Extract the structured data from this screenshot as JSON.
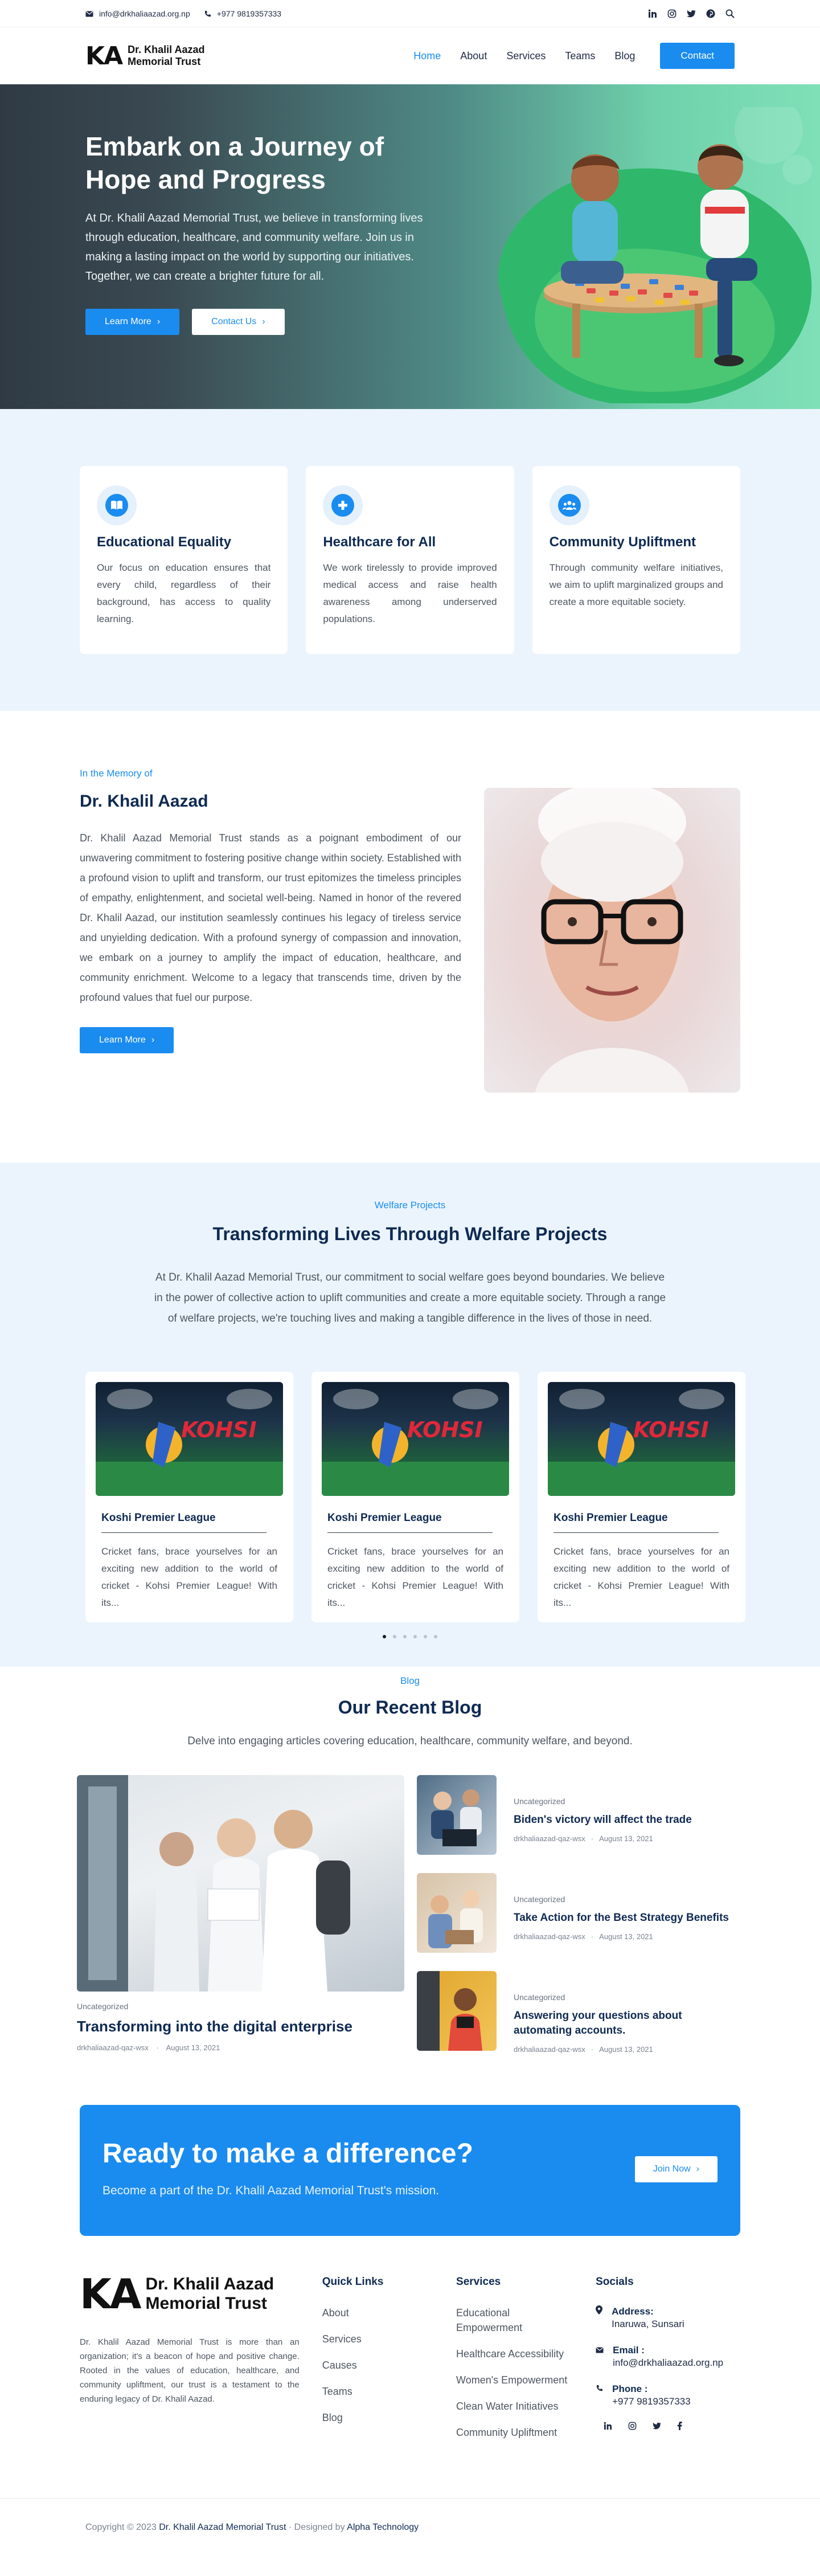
{
  "topbar": {
    "email": "info@drkhaliaazad.org.np",
    "phone": "+977 9819357333",
    "social_icons": [
      "linkedin-icon",
      "instagram-icon",
      "twitter-icon",
      "pinterest-icon",
      "search-icon"
    ]
  },
  "header": {
    "logo_mark": "KA",
    "logo_line1": "Dr. Khalil Aazad",
    "logo_line2": "Memorial Trust",
    "nav": [
      "Home",
      "About",
      "Services",
      "Teams",
      "Blog"
    ],
    "active_nav": "Home",
    "contact_button": "Contact"
  },
  "hero": {
    "title_line1": "Embark on a Journey of",
    "title_line2": "Hope and Progress",
    "text": "At Dr. Khalil Aazad Memorial Trust, we believe in transforming lives through education, healthcare, and community welfare. Join us in making a lasting impact on the world by supporting our initiatives. Together, we can create a brighter future for all.",
    "learn_more": "Learn More",
    "contact_us": "Contact Us"
  },
  "features": [
    {
      "icon": "book-icon",
      "title": "Educational Equality",
      "text": "Our focus on education ensures that every child, regardless of their background, has access to quality learning."
    },
    {
      "icon": "plus-medical-icon",
      "title": "Healthcare for All",
      "text": "We work tirelessly to provide improved medical access and raise health awareness among underserved populations."
    },
    {
      "icon": "community-icon",
      "title": "Community Upliftment",
      "text": "Through community welfare initiatives, we aim to uplift marginalized groups and create a more equitable society."
    }
  ],
  "memory": {
    "tag": "In the Memory of",
    "title": "Dr. Khalil Aazad",
    "text": "Dr. Khalil Aazad Memorial Trust stands as a poignant embodiment of our unwavering commitment to fostering positive change within society. Established with a profound vision to uplift and transform, our trust epitomizes the timeless principles of empathy, enlightenment, and societal well-being. Named in honor of the revered Dr. Khalil Aazad, our institution seamlessly continues his legacy of tireless service and unyielding dedication. With a profound synergy of compassion and innovation, we embark on a journey to amplify the impact of education, healthcare, and community enrichment. Welcome to a legacy that transcends time, driven by the profound values that fuel our purpose.",
    "button": "Learn More"
  },
  "projects": {
    "tag": "Welfare Projects",
    "title": "Transforming Lives Through Welfare Projects",
    "intro": "At Dr. Khalil Aazad Memorial Trust, our commitment to social welfare goes beyond boundaries. We believe in the power of collective action to uplift communities and create a more equitable society. Through a range of welfare projects, we're touching lives and making a tangible difference in the lives of those in need.",
    "cards": [
      {
        "title": "Koshi Premier League",
        "text": "Cricket fans, brace yourselves for an exciting new addition to the world of cricket - Kohsi Premier League! With its...",
        "logo": "KOHSI"
      },
      {
        "title": "Koshi Premier League",
        "text": "Cricket fans, brace yourselves for an exciting new addition to the world of cricket - Kohsi Premier League! With its...",
        "logo": "KOHSI"
      },
      {
        "title": "Koshi Premier League",
        "text": "Cricket fans, brace yourselves for an exciting new addition to the world of cricket - Kohsi Premier League! With its...",
        "logo": "KOHSI"
      }
    ],
    "dots": 6,
    "active_dot": 1
  },
  "blog": {
    "tag": "Blog",
    "title": "Our Recent Blog",
    "intro": "Delve into engaging articles covering education, healthcare, community welfare, and beyond.",
    "main": {
      "category": "Uncategorized",
      "title": "Transforming into the digital enterprise",
      "author": "drkhaliaazad-qaz-wsx",
      "date": "August 13, 2021"
    },
    "posts": [
      {
        "category": "Uncategorized",
        "title": "Biden's victory will affect the trade",
        "author": "drkhaliaazad-qaz-wsx",
        "date": "August 13, 2021"
      },
      {
        "category": "Uncategorized",
        "title": "Take Action for the Best Strategy Benefits",
        "author": "drkhaliaazad-qaz-wsx",
        "date": "August 13, 2021"
      },
      {
        "category": "Uncategorized",
        "title": "Answering your questions about automating accounts.",
        "author": "drkhaliaazad-qaz-wsx",
        "date": "August 13, 2021"
      }
    ]
  },
  "cta": {
    "title": "Ready to make a difference?",
    "text": "Become a part of the Dr. Khalil Aazad Memorial Trust's mission.",
    "button": "Join Now"
  },
  "footer": {
    "about": "Dr. Khalil Aazad Memorial Trust is more than an organization; it's a beacon of hope and positive change. Rooted in the values of education, healthcare, and community upliftment, our trust is a testament to the enduring legacy of Dr. Khalil Aazad.",
    "quick_links_title": "Quick Links",
    "quick_links": [
      "About",
      "Services",
      "Causes",
      "Teams",
      "Blog"
    ],
    "services_title": "Services",
    "services": [
      "Educational Empowerment",
      "Healthcare Accessibility",
      "Women's Empowerment",
      "Clean Water Initiatives",
      "Community Upliftment"
    ],
    "socials_title": "Socials",
    "address_label": "Address:",
    "address": "Inaruwa, Sunsari",
    "email_label": "Email :",
    "email": "info@drkhaliaazad.org.np",
    "phone_label": "Phone :",
    "phone": "+977 9819357333",
    "social_icons": [
      "linkedin-icon",
      "instagram-icon",
      "twitter-icon",
      "facebook-icon"
    ]
  },
  "copyright": {
    "prefix": "Copyright © 2023",
    "org": "Dr. Khalil Aazad Memorial Trust",
    "mid": "· Designed by",
    "designer": "Alpha Technology"
  },
  "colors": {
    "accent": "#1a8cf0",
    "heading": "#0f2a52",
    "section_bg": "#ebf4fd"
  }
}
